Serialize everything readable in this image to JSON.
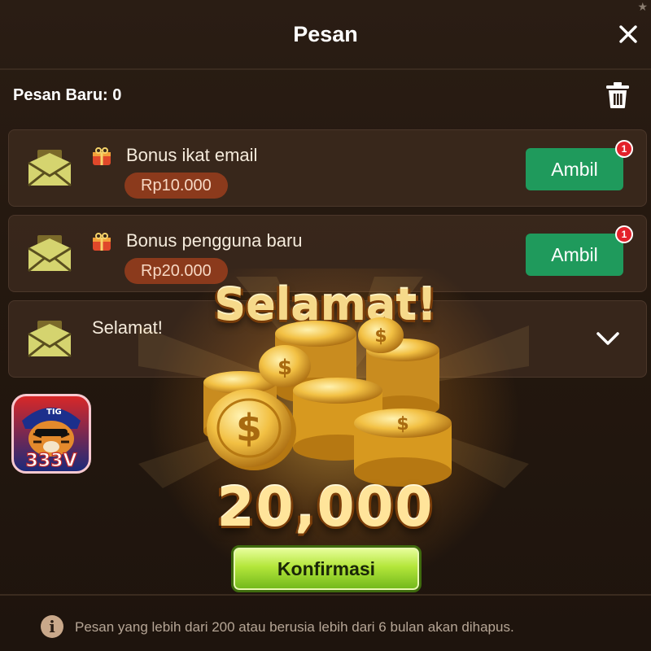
{
  "header": {
    "title": "Pesan",
    "close_icon": "close-icon",
    "corner_star": "★"
  },
  "subbar": {
    "new_messages_label": "Pesan Baru: 0",
    "trash_icon": "trash-icon"
  },
  "messages": [
    {
      "title": "Bonus ikat email",
      "amount": "Rp10.000",
      "button": "Ambil",
      "badge": "1",
      "icon": "envelope-icon",
      "tag_icon": "gift-icon"
    },
    {
      "title": "Bonus pengguna baru",
      "amount": "Rp20.000",
      "button": "Ambil",
      "badge": "1",
      "icon": "envelope-icon",
      "tag_icon": "gift-icon"
    },
    {
      "title": "Selamat!",
      "icon": "envelope-icon",
      "expand_icon": "chevron-down-icon"
    }
  ],
  "logo": {
    "text": "333V",
    "cap_text": "TIG"
  },
  "reward": {
    "title": "Selamat!",
    "amount": "20,000",
    "confirm_label": "Konfirmasi"
  },
  "footer": {
    "notice": "Pesan yang lebih dari 200 atau berusia lebih dari 6 bulan akan dihapus.",
    "info_glyph": "i"
  },
  "colors": {
    "accent_green": "#1f9a5c",
    "badge_red": "#e3212a",
    "amount_pill": "#8b3a1c",
    "gold": "#f6d98a",
    "confirm_green": "#b3e63a"
  }
}
